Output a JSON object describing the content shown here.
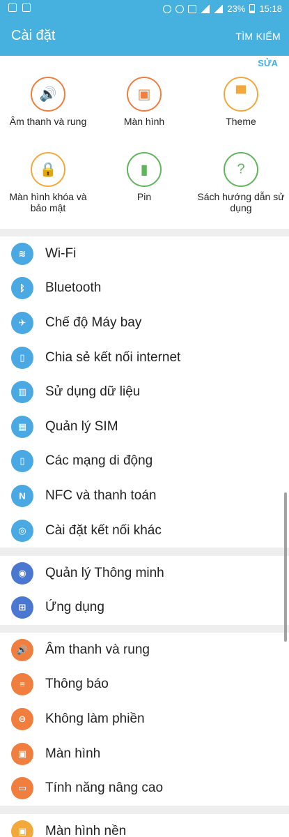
{
  "status_bar": {
    "battery": "23%",
    "time": "15:18"
  },
  "app_bar": {
    "title": "Cài đặt",
    "search_action": "TÌM KIẾM"
  },
  "quick_settings": {
    "edit_label": "SỬA",
    "items": [
      {
        "label": "Âm thanh và rung",
        "icon": "speaker-icon",
        "color": "#f07e3e"
      },
      {
        "label": "Màn hình",
        "icon": "display-settings-icon",
        "color": "#f07e3e"
      },
      {
        "label": "Theme",
        "icon": "paintbrush-icon",
        "color": "#f3a83c"
      },
      {
        "label": "Màn hình khóa và bảo mật",
        "icon": "lock-icon",
        "color": "#f3a83c"
      },
      {
        "label": "Pin",
        "icon": "battery-icon",
        "color": "#5fb65a"
      },
      {
        "label": "Sách hướng dẫn sử dụng",
        "icon": "help-book-icon",
        "color": "#5fb65a"
      }
    ]
  },
  "sections": [
    {
      "items": [
        {
          "label": "Wi-Fi",
          "icon": "wifi-icon",
          "color": "#4aa9e3"
        },
        {
          "label": "Bluetooth",
          "icon": "bluetooth-icon",
          "color": "#4aa9e3"
        },
        {
          "label": "Chế độ Máy bay",
          "icon": "airplane-icon",
          "color": "#4aa9e3"
        },
        {
          "label": "Chia sẻ kết nối internet",
          "icon": "hotspot-icon",
          "color": "#4aa9e3"
        },
        {
          "label": "Sử dụng dữ liệu",
          "icon": "data-usage-icon",
          "color": "#4aa9e3"
        },
        {
          "label": "Quản lý SIM",
          "icon": "sim-card-icon",
          "color": "#4aa9e3"
        },
        {
          "label": "Các mạng di động",
          "icon": "mobile-network-icon",
          "color": "#4aa9e3"
        },
        {
          "label": "NFC và thanh toán",
          "icon": "nfc-icon",
          "color": "#4aa9e3"
        },
        {
          "label": "Cài đặt kết nối khác",
          "icon": "more-connections-icon",
          "color": "#4aa9e3"
        }
      ]
    },
    {
      "items": [
        {
          "label": "Quản lý Thông minh",
          "icon": "smart-manager-icon",
          "color": "#4a78d1"
        },
        {
          "label": "Ứng dụng",
          "icon": "apps-icon",
          "color": "#4a78d1"
        }
      ]
    },
    {
      "items": [
        {
          "label": "Âm thanh và rung",
          "icon": "speaker-icon",
          "color": "#f07e3e"
        },
        {
          "label": "Thông báo",
          "icon": "notification-icon",
          "color": "#f07e3e"
        },
        {
          "label": "Không làm phiền",
          "icon": "do-not-disturb-icon",
          "color": "#f07e3e"
        },
        {
          "label": "Màn hình",
          "icon": "display-settings-icon",
          "color": "#f07e3e"
        },
        {
          "label": "Tính năng nâng cao",
          "icon": "advanced-features-icon",
          "color": "#f07e3e"
        }
      ]
    },
    {
      "items": [
        {
          "label": "Màn hình nền",
          "icon": "wallpaper-icon",
          "color": "#f3a83c"
        }
      ]
    }
  ]
}
